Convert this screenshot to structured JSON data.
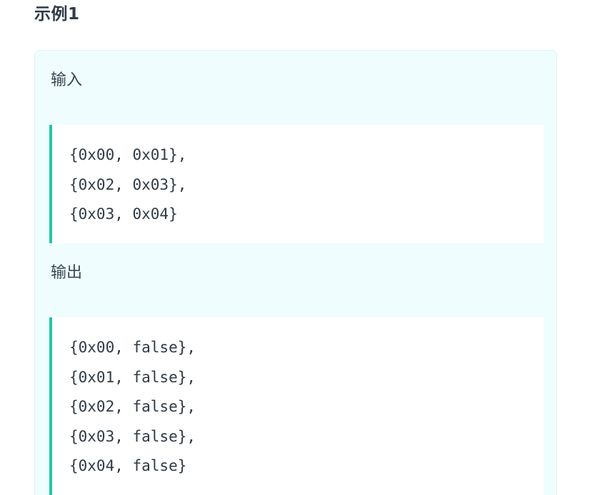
{
  "example": {
    "title": "示例1",
    "input_label": "输入",
    "input_lines": [
      "{0x00, 0x01},",
      "{0x02, 0x03},",
      "{0x03, 0x04}"
    ],
    "output_label": "输出",
    "output_lines": [
      "{0x00, false},",
      "{0x01, false},",
      "{0x02, false},",
      "{0x03, false},",
      "{0x04, false}"
    ]
  },
  "colors": {
    "box_background": "#f0fdfe",
    "code_background": "#ffffff",
    "accent_border": "#1cc7a7",
    "text": "#2f3a47"
  }
}
